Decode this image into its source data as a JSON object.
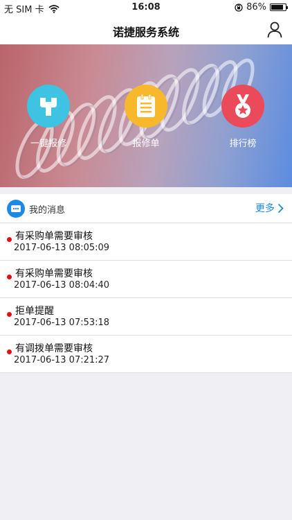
{
  "status_bar": {
    "carrier": "无 SIM 卡",
    "time": "16:08",
    "battery": "86%",
    "battery_level": 0.86
  },
  "nav": {
    "title": "诺捷服务系统"
  },
  "banner": {
    "items": [
      {
        "label": "一键报修",
        "icon": "wrench-icon",
        "color": "#3ec3e2"
      },
      {
        "label": "报修单",
        "icon": "clipboard-icon",
        "color": "#f7b82b"
      },
      {
        "label": "排行榜",
        "icon": "medal-icon",
        "color": "#ea4a5a"
      }
    ]
  },
  "messages": {
    "title": "我的消息",
    "more_label": "更多",
    "items": [
      {
        "text": "有采购单需要审核",
        "time": "2017-06-13 08:05:09"
      },
      {
        "text": "有采购单需要审核",
        "time": "2017-06-13 08:04:40"
      },
      {
        "text": "拒单提醒",
        "time": "2017-06-13 07:53:18"
      },
      {
        "text": "有调拨单需要审核",
        "time": "2017-06-13 07:21:27"
      }
    ]
  },
  "colors": {
    "accent": "#1e88e5",
    "unread_dot": "#e11111"
  }
}
